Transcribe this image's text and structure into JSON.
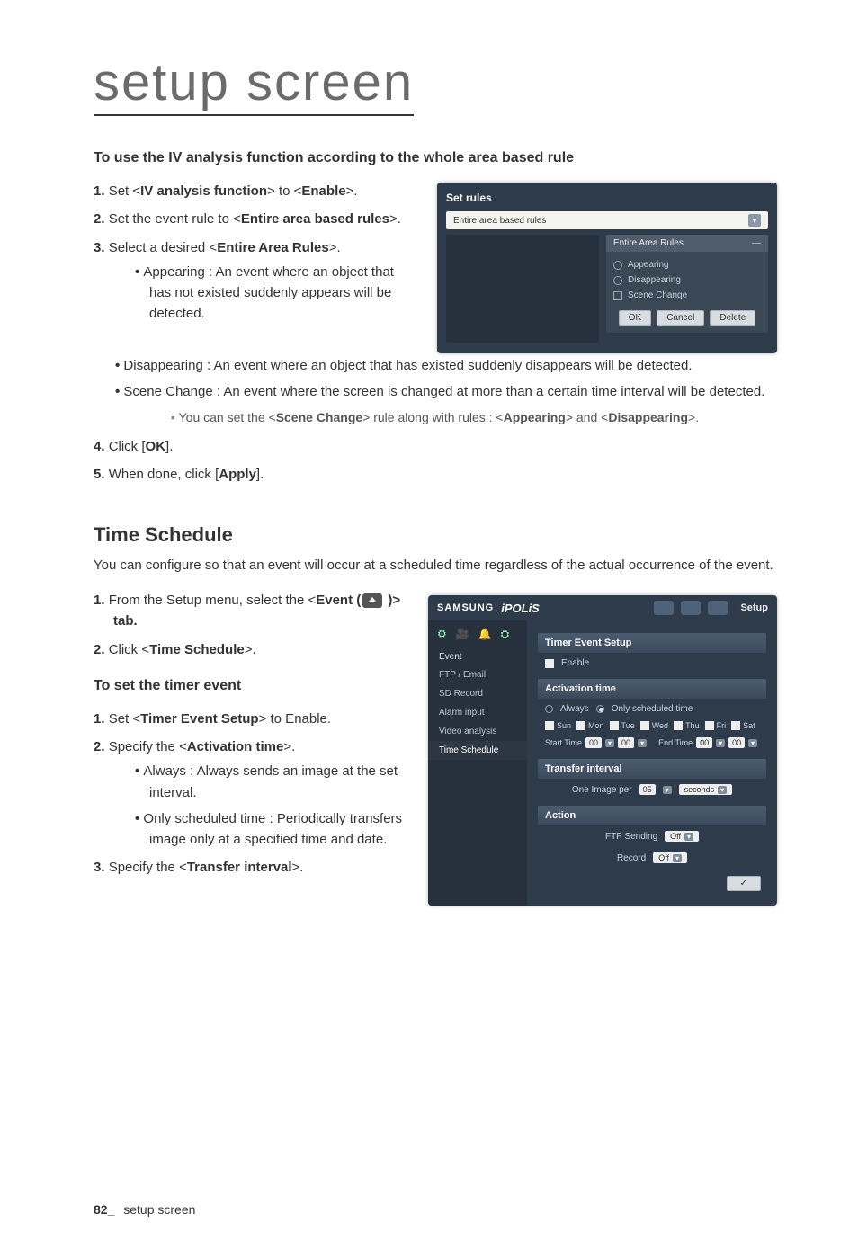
{
  "page": {
    "title": "setup screen",
    "footer_page": "82_",
    "footer_label": "setup screen"
  },
  "section1": {
    "heading": "To use the IV analysis function according to the whole area based rule",
    "steps": {
      "s1_pre": "Set <",
      "s1_b1": "IV analysis function",
      "s1_mid": "> to <",
      "s1_b2": "Enable",
      "s1_post": ">.",
      "s2_pre": "Set the event rule to <",
      "s2_b1": "Entire area based rules",
      "s2_post": ">.",
      "s3_pre": "Select a desired <",
      "s3_b1": "Entire Area Rules",
      "s3_post": ">.",
      "s4_pre": "Click [",
      "s4_b1": "OK",
      "s4_post": "].",
      "s5_pre": "When done, click [",
      "s5_b1": "Apply",
      "s5_post": "]."
    },
    "bullets": {
      "b1": "Appearing : An event where an object that has not existed suddenly appears will be detected.",
      "b2": "Disappearing : An event where an object that has existed suddenly disappears will be detected.",
      "b3": "Scene Change : An event where the screen is changed at more than a certain time interval will be detected.",
      "sub_pre": "You can set the <",
      "sub_b1": "Scene Change",
      "sub_mid1": "> rule along with rules : <",
      "sub_b2": "Appearing",
      "sub_mid2": "> and <",
      "sub_b3": "Disappearing",
      "sub_post": ">."
    }
  },
  "fig1": {
    "title": "Set rules",
    "dropdown": "Entire area based rules",
    "panel_title": "Entire Area Rules",
    "opt1": "Appearing",
    "opt2": "Disappearing",
    "opt3": "Scene Change",
    "btn_ok": "OK",
    "btn_cancel": "Cancel",
    "btn_delete": "Delete"
  },
  "section2": {
    "heading": "Time Schedule",
    "para": "You can configure so that an event will occur at a scheduled time regardless of the actual occurrence of the event.",
    "steps": {
      "s1_pre": "From the Setup menu, select the <",
      "s1_b1": "Event (",
      "s1_post": " )> tab.",
      "s2_pre": "Click <",
      "s2_b1": "Time Schedule",
      "s2_post": ">."
    },
    "subheading": "To set the timer event",
    "steps2": {
      "s1_pre": "Set <",
      "s1_b1": "Timer Event Setup",
      "s1_post": "> to Enable.",
      "s2_pre": "Specify the <",
      "s2_b1": "Activation time",
      "s2_post": ">.",
      "s3_pre": "Specify the <",
      "s3_b1": "Transfer interval",
      "s3_post": ">."
    },
    "bullets": {
      "b1": "Always : Always sends an image at the set interval.",
      "b2": "Only scheduled time : Periodically transfers image only at a specified time and date."
    }
  },
  "fig2": {
    "brand1": "SAMSUNG",
    "brand2": "iPOLiS",
    "tab_label": "Setup",
    "side_heading": "Event",
    "side_items": [
      "FTP / Email",
      "SD Record",
      "Alarm input",
      "Video analysis",
      "Time Schedule"
    ],
    "m1": "Timer Event Setup",
    "enable": "Enable",
    "m2": "Activation time",
    "opt_always": "Always",
    "opt_sched": "Only scheduled time",
    "days": [
      "Sun",
      "Mon",
      "Tue",
      "Wed",
      "Thu",
      "Fri",
      "Sat"
    ],
    "start_label": "Start Time",
    "end_label": "End Time",
    "t_h": "00",
    "t_m": "00",
    "m3": "Transfer interval",
    "ti_pre": "One Image per",
    "ti_val": "05",
    "ti_unit": "seconds",
    "m4": "Action",
    "act1_label": "FTP Sending",
    "act2_label": "Record",
    "off": "Off",
    "apply": "✓"
  }
}
